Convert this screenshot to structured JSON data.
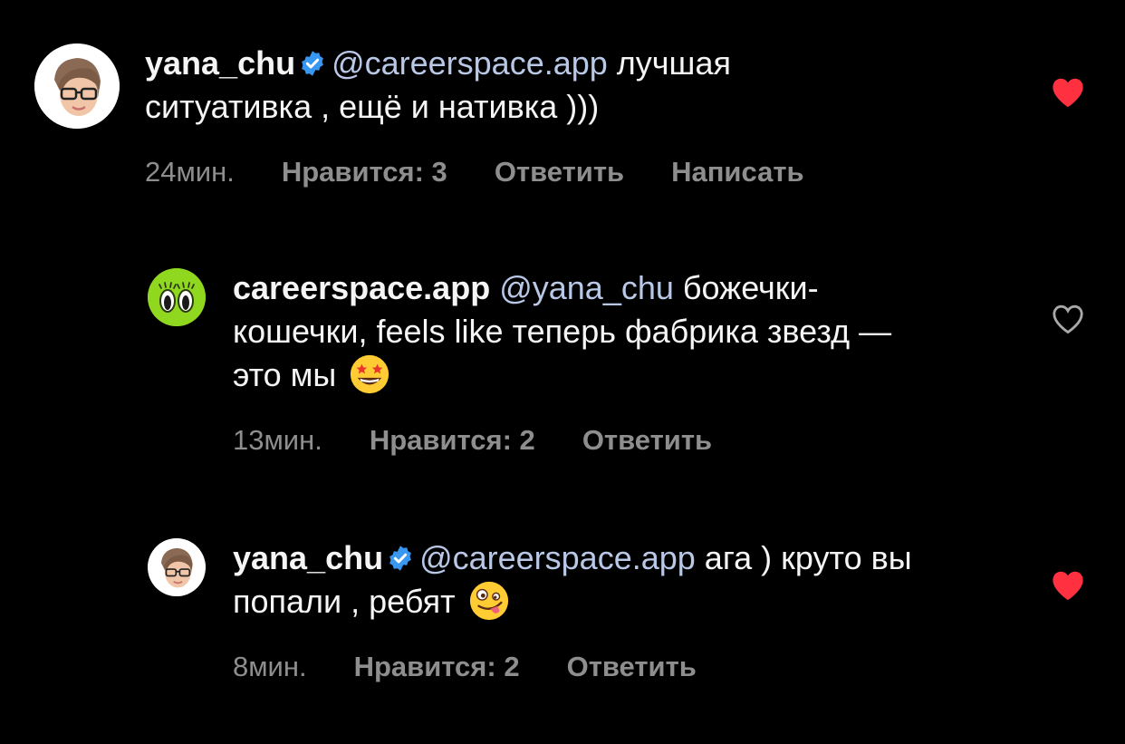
{
  "comments": [
    {
      "username": "yana_chu",
      "verified": true,
      "mention": "@careerspace.app",
      "text": " лучшая ситуативка , ещё и  нативка )))",
      "time": "24мин.",
      "likes_label": "Нравится: 3",
      "reply_label": "Ответить",
      "message_label": "Написать",
      "liked": true,
      "avatar_icon": "memoji-avatar-icon"
    },
    {
      "username": "careerspace.app",
      "verified": false,
      "mention": "@yana_chu",
      "text": " божечки-кошечки, feels like теперь фабрика звезд — это мы ",
      "emoji": "star-struck-emoji",
      "time": "13мин.",
      "likes_label": "Нравится: 2",
      "reply_label": "Ответить",
      "liked": false,
      "avatar_icon": "careerspace-eyes-logo"
    },
    {
      "username": "yana_chu",
      "verified": true,
      "mention": "@careerspace.app",
      "text": " ага ) круто вы попали , ребят ",
      "emoji": "zany-face-emoji",
      "time": "8мин.",
      "likes_label": "Нравится: 2",
      "reply_label": "Ответить",
      "liked": true,
      "avatar_icon": "memoji-avatar-icon"
    }
  ],
  "colors": {
    "background": "#000000",
    "text": "#f5f5f5",
    "mention": "#b9c8e6",
    "meta": "#8e8e8e",
    "like_active": "#ff3040",
    "verified": "#3897f0",
    "brand_green": "#8fd81f"
  }
}
